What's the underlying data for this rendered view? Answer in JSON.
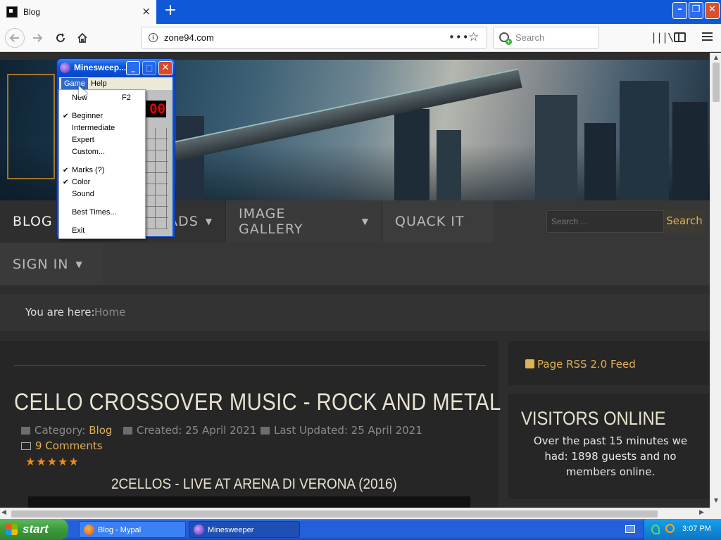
{
  "browser": {
    "tab_title": "Blog",
    "tab_close": "×",
    "new_tab": "+",
    "url": "zone94.com",
    "page_actions": "•••",
    "search_placeholder": "Search",
    "window_controls": {
      "minimize": "–",
      "maximize": "❐",
      "close": "✕"
    }
  },
  "site": {
    "nav": [
      {
        "label": "BLOG",
        "has_caret": false
      },
      {
        "label": "ADS",
        "has_caret": true
      },
      {
        "label": "IMAGE GALLERY",
        "has_caret": true
      },
      {
        "label": "QUACK IT",
        "has_caret": false
      },
      {
        "label": "SIGN IN",
        "has_caret": true
      }
    ],
    "caret": "▼",
    "search_placeholder": "Search ...",
    "search_button": "Search",
    "breadcrumb": {
      "label": "You are here:",
      "current": "Home"
    },
    "article": {
      "title": "CELLO CROSSOVER MUSIC - ROCK AND METAL",
      "category_label": "Category:",
      "category": "Blog",
      "created": "Created: 25 April 2021",
      "updated": "Last Updated: 25 April 2021",
      "comments": "9 Comments",
      "rating_stars": "★★★★★",
      "video_title": "2CELLOS - LIVE AT ARENA DI VERONA (2016)"
    },
    "sidebar": {
      "rss": "Page RSS 2.0 Feed",
      "visitors_title": "VISITORS ONLINE",
      "visitors_text": "Over the past 15 minutes we had: 1898 guests and no members online."
    }
  },
  "minesweeper": {
    "title": "Minesweep...",
    "controls": {
      "minimize": "_",
      "maximize": "□",
      "close": "✕"
    },
    "menubar": {
      "game": "Game",
      "help": "Help"
    },
    "counter": "00",
    "game_menu": [
      {
        "label": "New",
        "shortcut": "F2",
        "checked": false
      },
      {
        "label": "Beginner",
        "checked": true
      },
      {
        "label": "Intermediate",
        "checked": false
      },
      {
        "label": "Expert",
        "checked": false
      },
      {
        "label": "Custom...",
        "checked": false
      },
      {
        "label": "Marks (?)",
        "checked": true
      },
      {
        "label": "Color",
        "checked": true
      },
      {
        "label": "Sound",
        "checked": false
      },
      {
        "label": "Best Times...",
        "checked": false
      },
      {
        "label": "Exit",
        "checked": false
      }
    ],
    "check_glyph": "✔"
  },
  "taskbar": {
    "start": "start",
    "tasks": [
      {
        "label": "Blog - Mypal"
      },
      {
        "label": "Minesweeper"
      }
    ],
    "clock": "3:07 PM"
  },
  "scrollbar_glyphs": {
    "up": "▲",
    "down": "▼",
    "left": "◀",
    "right": "▶"
  }
}
